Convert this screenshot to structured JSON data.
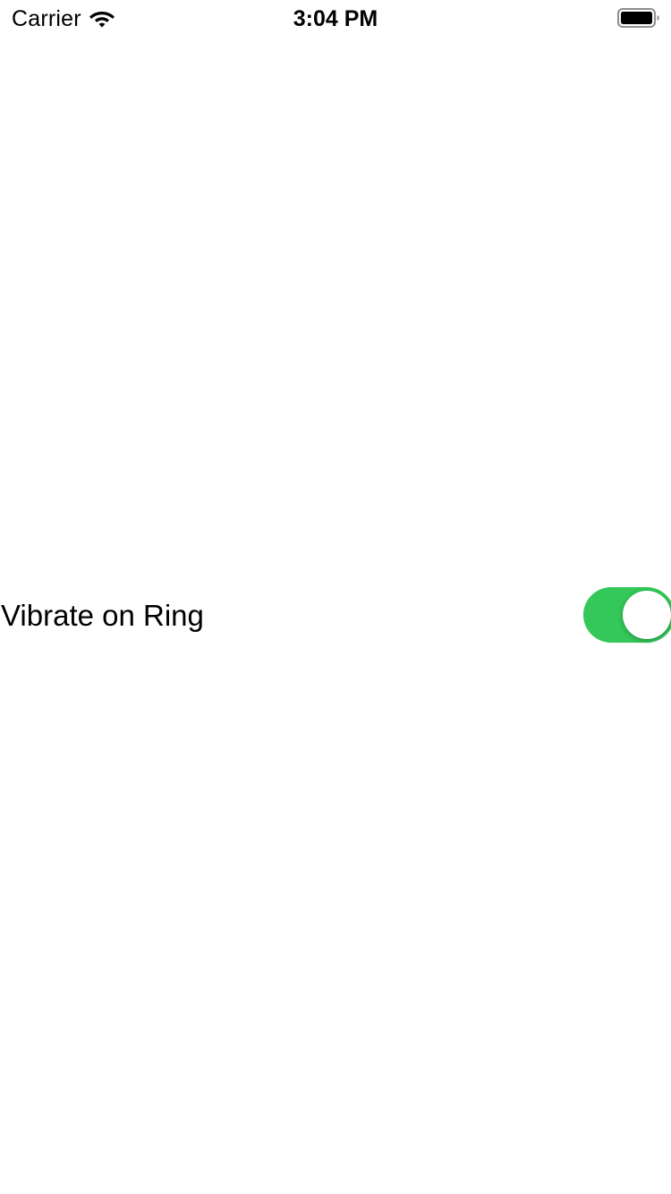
{
  "status_bar": {
    "carrier": "Carrier",
    "time": "3:04 PM",
    "wifi_icon": "wifi-icon",
    "battery_icon": "battery-full-icon"
  },
  "settings": {
    "vibrate_on_ring": {
      "label": "Vibrate on Ring",
      "enabled": true
    }
  },
  "colors": {
    "toggle_on": "#34c759",
    "background": "#ffffff",
    "text": "#000000"
  }
}
